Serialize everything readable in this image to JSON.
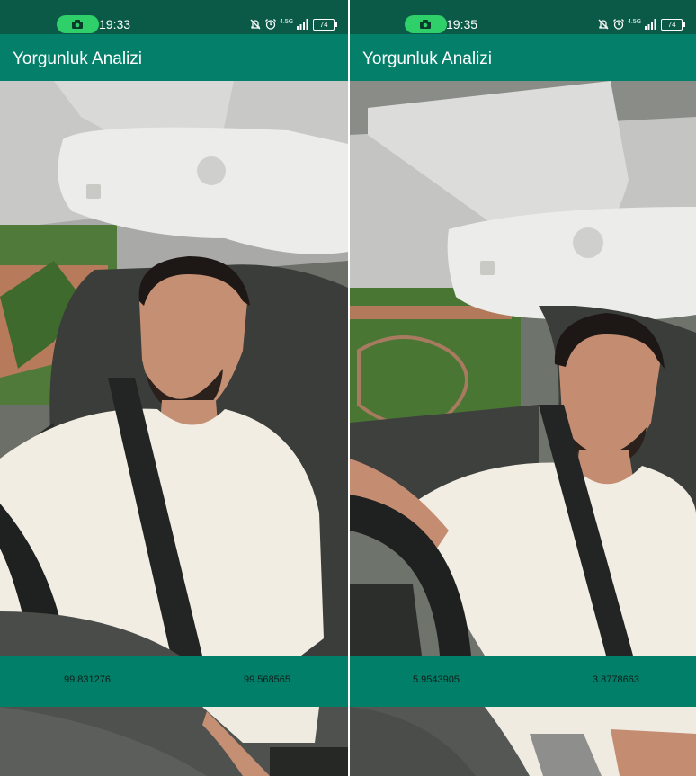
{
  "panels": [
    {
      "status": {
        "time": "19:33",
        "network": "4.5G",
        "battery": "74"
      },
      "app_title": "Yorgunluk Analizi",
      "scores": [
        "99.831276",
        "99.568565"
      ]
    },
    {
      "status": {
        "time": "19:35",
        "network": "4.5G",
        "battery": "74"
      },
      "app_title": "Yorgunluk Analizi",
      "scores": [
        "5.9543905",
        "3.8778663"
      ]
    }
  ],
  "colors": {
    "status_bar": "#0a5a47",
    "app_bar": "#037f6a",
    "result_bar": "#017f68",
    "camera_pill": "#2fd06a"
  },
  "icons": [
    "camera-icon",
    "mute-icon",
    "alarm-icon",
    "signal-icon",
    "battery-icon"
  ]
}
